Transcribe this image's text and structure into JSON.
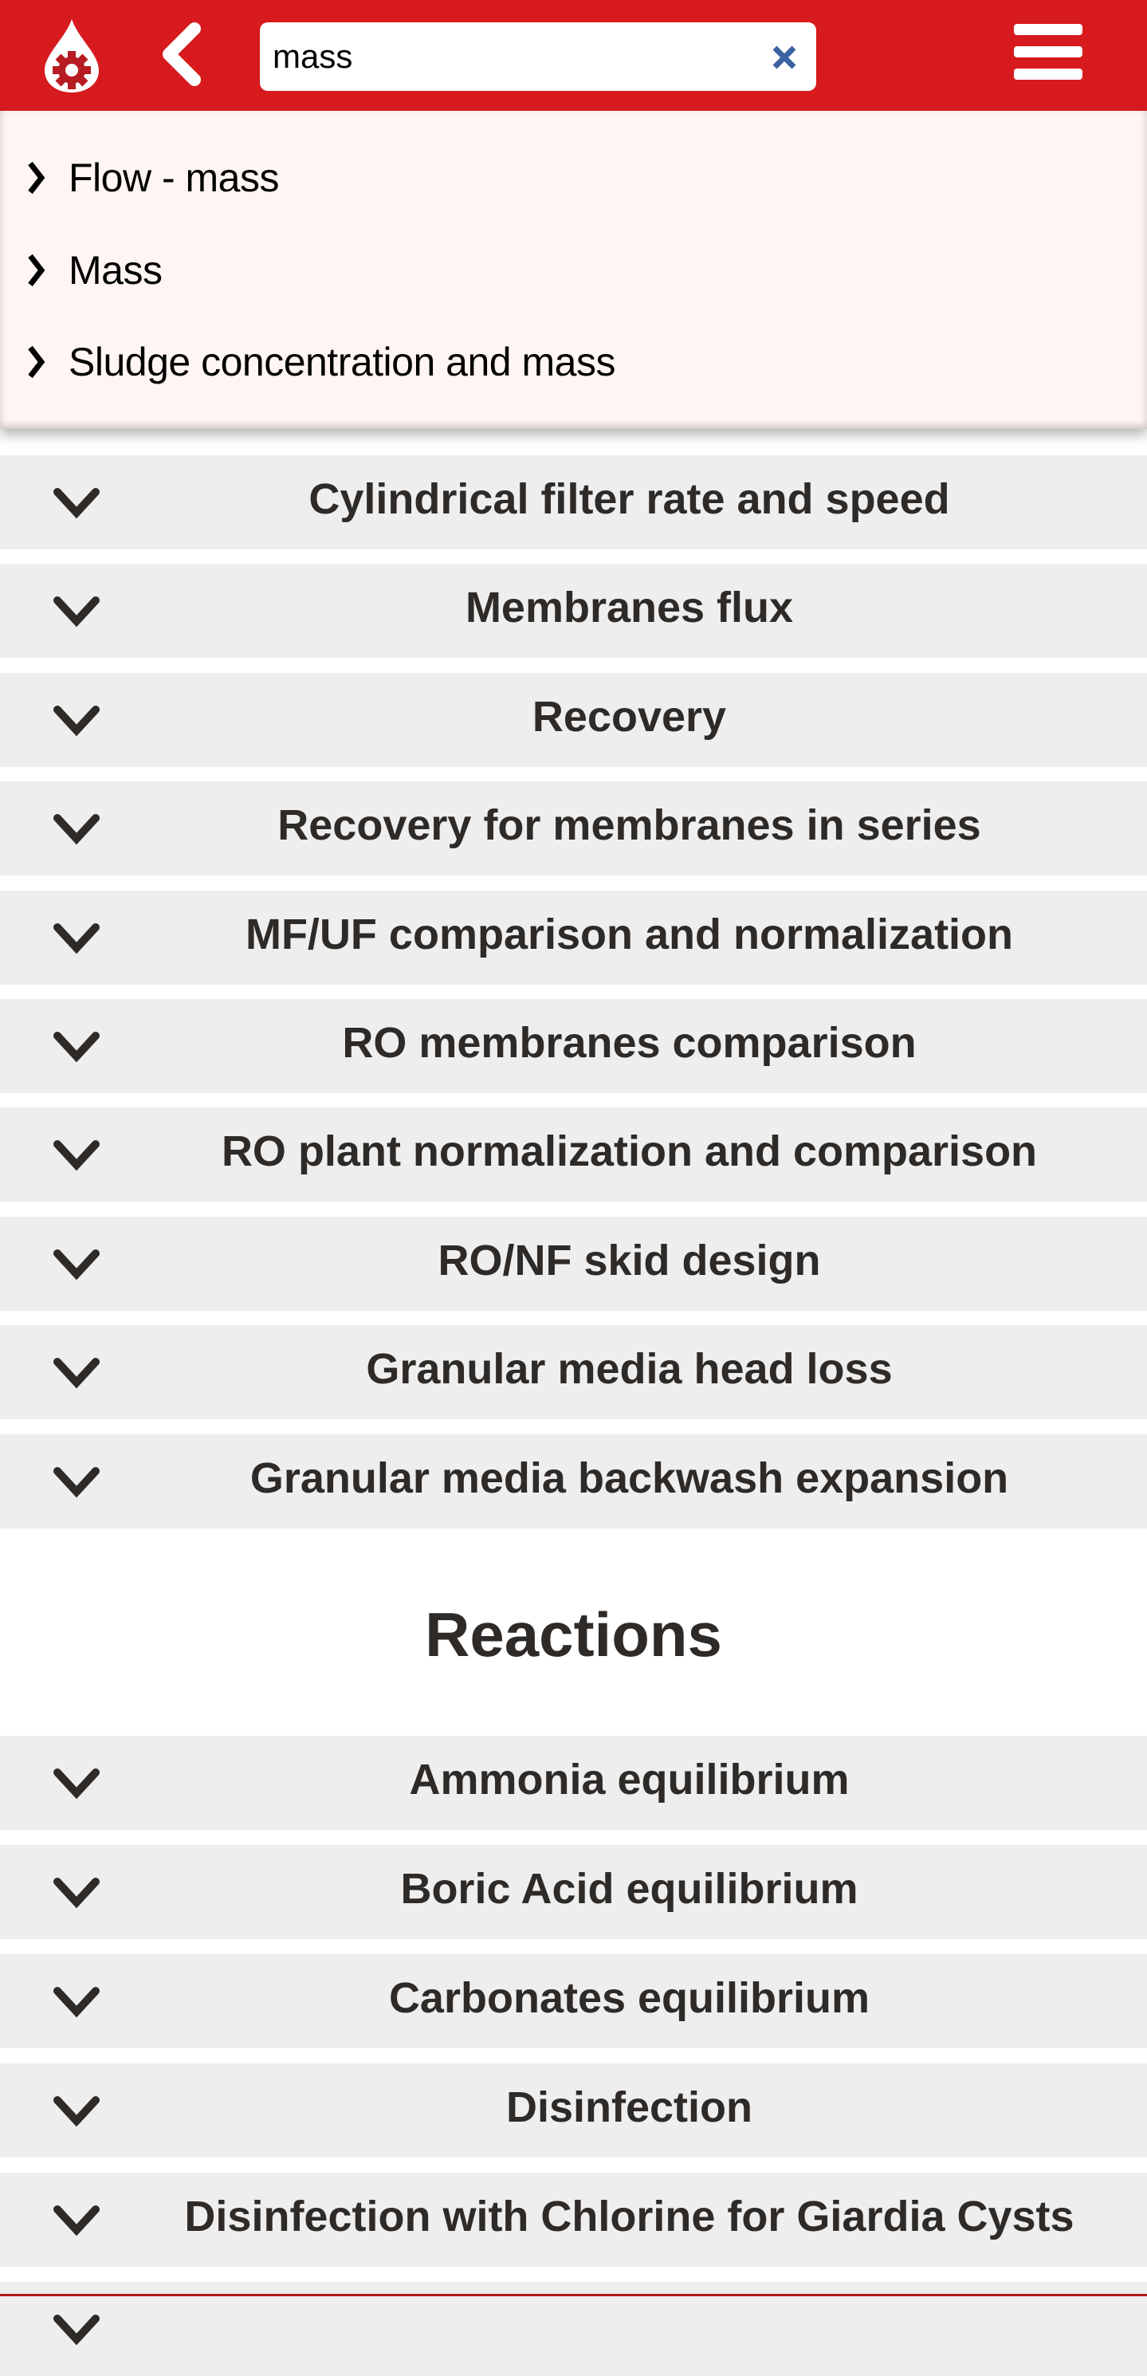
{
  "header": {
    "logo_icon": "water-drop-gear-icon",
    "back_icon": "chevron-left-icon",
    "search": {
      "value": "mass",
      "placeholder": ""
    },
    "clear_icon": "close-icon",
    "menu_icon": "hamburger-menu-icon"
  },
  "suggestions": [
    {
      "label": "Flow - mass",
      "icon": "chevron-right-icon"
    },
    {
      "label": "Mass",
      "icon": "chevron-right-icon"
    },
    {
      "label": "Sludge concentration and mass",
      "icon": "chevron-right-icon"
    }
  ],
  "sections": [
    {
      "title": "",
      "items": [
        {
          "label": "Cylindrical filter rate and speed"
        },
        {
          "label": "Membranes flux"
        },
        {
          "label": "Recovery"
        },
        {
          "label": "Recovery for membranes in series"
        },
        {
          "label": "MF/UF comparison and normalization"
        },
        {
          "label": "RO membranes comparison"
        },
        {
          "label": "RO plant normalization and comparison"
        },
        {
          "label": "RO/NF skid design"
        },
        {
          "label": "Granular media head loss"
        },
        {
          "label": "Granular media backwash expansion"
        }
      ]
    },
    {
      "title": "Reactions",
      "items": [
        {
          "label": "Ammonia equilibrium"
        },
        {
          "label": "Boric Acid equilibrium"
        },
        {
          "label": "Carbonates equilibrium"
        },
        {
          "label": "Disinfection"
        },
        {
          "label": "Disinfection with Chlorine for Giardia Cysts"
        },
        {
          "label": ""
        }
      ]
    }
  ],
  "colors": {
    "brand_red": "#d71a1e",
    "suggest_bg": "#fff5f2",
    "row_bg": "#eeeeee",
    "text_dark": "#2e2a27",
    "clear_blue": "#3b62a0"
  }
}
